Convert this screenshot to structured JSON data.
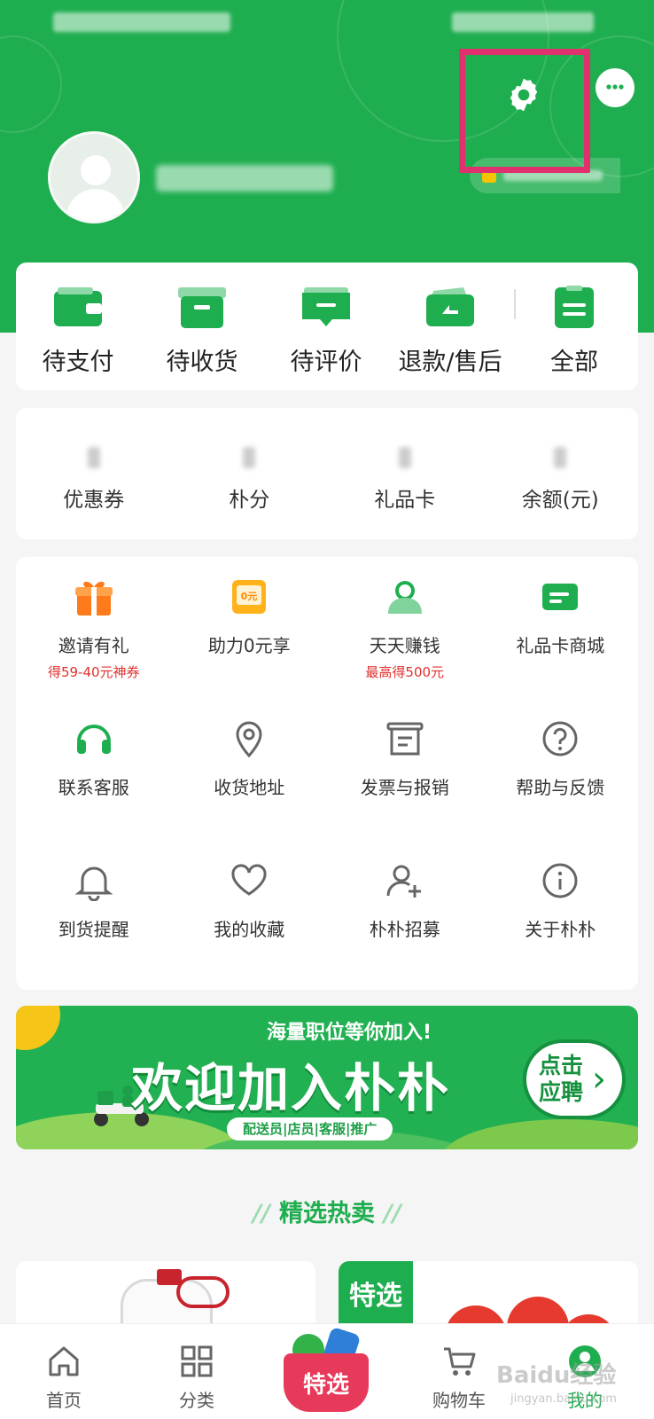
{
  "orders": [
    {
      "label": "待支付",
      "icon": "wallet-icon"
    },
    {
      "label": "待收货",
      "icon": "box-icon"
    },
    {
      "label": "待评价",
      "icon": "comment-icon"
    },
    {
      "label": "退款/售后",
      "icon": "refund-icon"
    },
    {
      "label": "全部",
      "icon": "orders-list-icon"
    }
  ],
  "assets": [
    {
      "label": "优惠券"
    },
    {
      "label": "朴分"
    },
    {
      "label": "礼品卡"
    },
    {
      "label": "余额(元)"
    }
  ],
  "services": [
    {
      "label": "邀请有礼",
      "sub": "得59-40元神券",
      "icon": "gift-icon"
    },
    {
      "label": "助力0元享",
      "sub": "",
      "icon": "zero-yuan-icon",
      "icon_text": "0元"
    },
    {
      "label": "天天赚钱",
      "sub": "最高得500元",
      "icon": "users-icon"
    },
    {
      "label": "礼品卡商城",
      "sub": "",
      "icon": "card-icon"
    },
    {
      "label": "联系客服",
      "icon": "headset-icon"
    },
    {
      "label": "收货地址",
      "icon": "location-pin-icon"
    },
    {
      "label": "发票与报销",
      "icon": "invoice-icon"
    },
    {
      "label": "帮助与反馈",
      "icon": "help-icon"
    },
    {
      "label": "到货提醒",
      "icon": "bell-icon"
    },
    {
      "label": "我的收藏",
      "icon": "heart-icon"
    },
    {
      "label": "朴朴招募",
      "icon": "add-user-icon"
    },
    {
      "label": "关于朴朴",
      "icon": "info-icon"
    }
  ],
  "banner": {
    "small_title": "海量职位等你加入!",
    "big_title": "欢迎加入朴朴",
    "tags": "配送员|店员|客服|推广",
    "cta": "点击应聘"
  },
  "section_title": "精选热卖",
  "product_tag": "特选",
  "tabs": [
    {
      "label": "首页",
      "icon": "home-icon"
    },
    {
      "label": "分类",
      "icon": "category-grid-icon"
    },
    {
      "label": "特选",
      "icon": "special-basket-icon"
    },
    {
      "label": "购物车",
      "icon": "cart-icon"
    },
    {
      "label": "我的",
      "icon": "profile-icon",
      "active": true
    }
  ],
  "watermark": {
    "main": "Baidu经验",
    "sub": "jingyan.baidu.com"
  },
  "colors": {
    "brand": "#1fae4f",
    "highlight": "#e0306e",
    "promo_red": "#e0312e"
  }
}
